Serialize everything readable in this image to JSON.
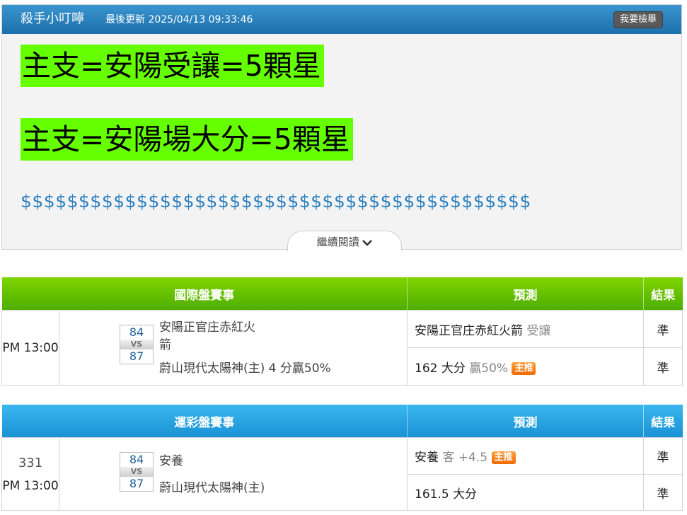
{
  "header": {
    "author": "殺手小叮嚀",
    "updated": "最後更新 2025/04/13 09:33:46",
    "report_button": "我要檢舉"
  },
  "article": {
    "line1": "主支=安陽受讓=5顆星",
    "line2": "主支=安陽場大分=5顆星",
    "dollars": "$$$$$$$$$$$$$$$$$$$$$$$$$$$$$$$$$$$$$$$$$$$$",
    "read_more": "繼續閱讀",
    "highlight_color": "#66ff00"
  },
  "international": {
    "headers": {
      "game": "國際盤賽事",
      "prediction": "預測",
      "result": "結果"
    },
    "time": "PM 13:00",
    "away_score": "84",
    "vs": "VS",
    "home_score": "87",
    "away_team_line1": "安陽正官庄赤紅火",
    "away_team_line2": "箭",
    "home_team": "蔚山現代太陽神(主) 4 分贏50%",
    "pred1_team": "安陽正官庄赤紅火箭",
    "pred1_note": "受讓",
    "pred1_result": "準",
    "pred2_value": "162 大分",
    "pred2_note": "贏50%",
    "pred2_badge": "主推",
    "pred2_result": "準"
  },
  "sportslottery": {
    "headers": {
      "game": "運彩盤賽事",
      "prediction": "預測",
      "result": "結果"
    },
    "game_no": "331",
    "time": "PM 13:00",
    "away_score": "84",
    "vs": "VS",
    "home_score": "87",
    "away_team": "安養",
    "home_team": "蔚山現代太陽神(主)",
    "pred1_team": "安養",
    "pred1_note": "客 +4.5",
    "pred1_badge": "主推",
    "pred1_result": "準",
    "pred2_value": "161.5 大分",
    "pred2_result": "準"
  }
}
